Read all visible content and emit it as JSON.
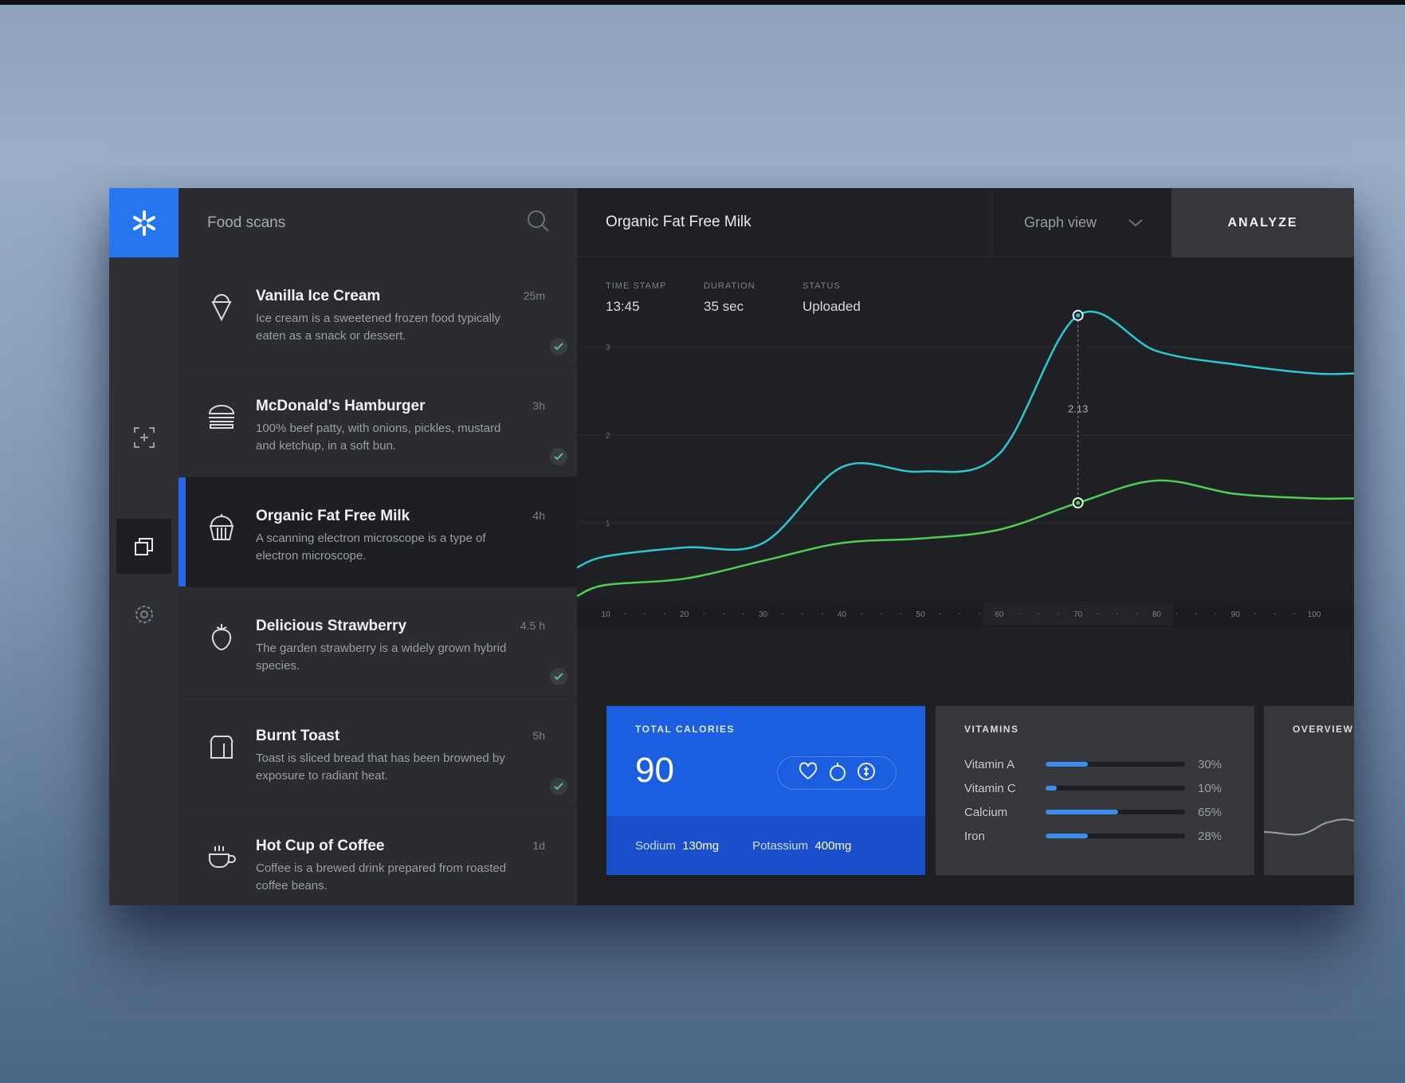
{
  "sidebar": {
    "icons": [
      "logo-icon",
      "scan-icon",
      "layers-icon",
      "settings-icon"
    ]
  },
  "list": {
    "title": "Food scans",
    "items": [
      {
        "title": "Vanilla Ice Cream",
        "desc": "Ice cream is a sweetened frozen food typically eaten as a snack or dessert.",
        "time": "25m",
        "icon": "ice-cream-icon",
        "checked": true
      },
      {
        "title": "McDonald's Hamburger",
        "desc": "100% beef patty, with onions, pickles, mustard and ketchup, in a soft bun.",
        "time": "3h",
        "icon": "hamburger-icon",
        "checked": true
      },
      {
        "title": "Organic Fat Free Milk",
        "desc": "A scanning electron microscope is a type of electron microscope.",
        "time": "4h",
        "icon": "cupcake-icon",
        "checked": false
      },
      {
        "title": "Delicious Strawberry",
        "desc": "The garden strawberry is a widely grown hybrid species.",
        "time": "4.5 h",
        "icon": "strawberry-icon",
        "checked": true
      },
      {
        "title": "Burnt Toast",
        "desc": "Toast is sliced bread that has been browned by exposure to radiant heat.",
        "time": "5h",
        "icon": "toast-icon",
        "checked": true
      },
      {
        "title": "Hot Cup of Coffee",
        "desc": "Coffee is a brewed drink prepared from roasted coffee beans.",
        "time": "1d",
        "icon": "coffee-icon",
        "checked": false
      }
    ]
  },
  "header": {
    "title": "Organic Fat Free Milk",
    "view": "Graph view",
    "analyze": "ANALYZE"
  },
  "meta": {
    "timestamp_label": "TIME STAMP",
    "timestamp": "13:45",
    "duration_label": "DURATION",
    "duration": "35 sec",
    "status_label": "STATUS",
    "status": "Uploaded"
  },
  "chart_data": {
    "type": "line",
    "x": [
      10,
      20,
      30,
      40,
      50,
      60,
      70,
      80,
      90,
      100
    ],
    "xticks": [
      "10",
      "20",
      "30",
      "40",
      "50",
      "60",
      "70",
      "80",
      "90",
      "100"
    ],
    "yticks": [
      "3",
      "2",
      "1"
    ],
    "highlight": {
      "x": 70,
      "label": "2.13"
    },
    "series": [
      {
        "color": "#2fc6d4",
        "values": [
          0.4,
          0.5,
          0.55,
          1.4,
          1.35,
          1.55,
          3.1,
          2.7,
          2.55,
          2.45
        ]
      },
      {
        "color": "#4fcf52",
        "values": [
          0.08,
          0.15,
          0.35,
          0.55,
          0.6,
          0.7,
          1.0,
          1.25,
          1.1,
          1.05
        ]
      }
    ]
  },
  "calories": {
    "label": "TOTAL CALORIES",
    "value": "90",
    "sodium_label": "Sodium",
    "sodium": "130mg",
    "potassium_label": "Potassium",
    "potassium": "400mg"
  },
  "vitamins": {
    "label": "VITAMINS",
    "rows": [
      {
        "name": "Vitamin A",
        "pct": "30%",
        "fill": 0.3
      },
      {
        "name": "Vitamin C",
        "pct": "10%",
        "fill": 0.08
      },
      {
        "name": "Calcium",
        "pct": "65%",
        "fill": 0.52
      },
      {
        "name": "Iron",
        "pct": "28%",
        "fill": 0.3
      }
    ]
  },
  "overview": {
    "label": "OVERVIEW"
  },
  "colors": {
    "accent": "#2576f0",
    "card_blue": "#1b5fe0",
    "line_cyan": "#2fc6d4",
    "line_green": "#4fcf52"
  }
}
